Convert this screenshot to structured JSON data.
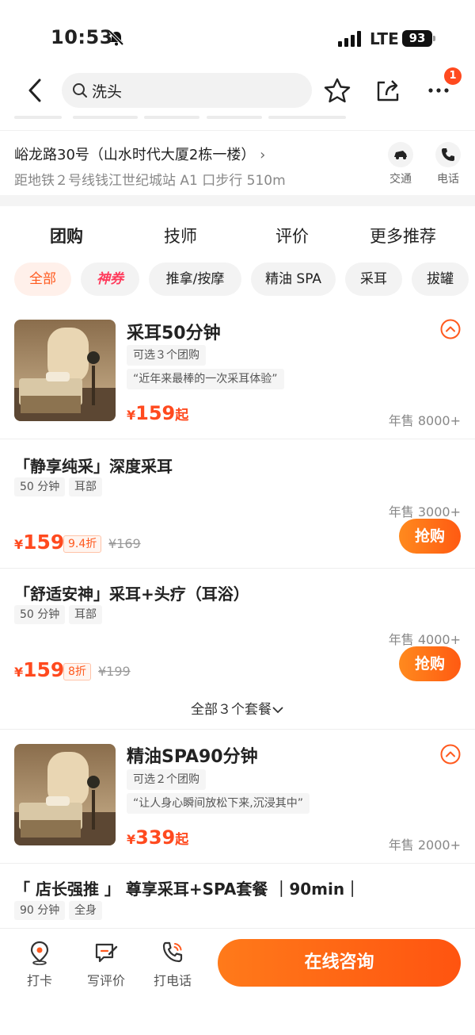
{
  "status_bar": {
    "time": "10:53",
    "network": "LTE",
    "battery": "93"
  },
  "nav": {
    "search_text": "洗头",
    "more_badge": "1"
  },
  "address": {
    "line1": "峪龙路30号（山水时代大厦2栋一楼）",
    "line2": "距地铁２号线钱江世纪城站 A1 口步行 510m",
    "traffic_label": "交通",
    "phone_label": "电话"
  },
  "tabs": [
    "团购",
    "技师",
    "评价",
    "更多推荐"
  ],
  "chips": [
    "全部",
    "神券",
    "推拿/按摩",
    "精油 SPA",
    "采耳",
    "拔罐"
  ],
  "groups": [
    {
      "title": "采耳50分钟",
      "tag1": "可选３个团购",
      "quote": "“近年来最棒的一次采耳体验”",
      "price_symbol": "¥",
      "price": "159",
      "price_suffix": "起",
      "sold": "年售 8000+"
    },
    {
      "title": "精油SPA90分钟",
      "tag1": "可选２个团购",
      "quote": "“让人身心瞬间放松下来,沉浸其中”",
      "price_symbol": "¥",
      "price": "339",
      "price_suffix": "起",
      "sold": "年售 2000+"
    }
  ],
  "items": [
    {
      "title": "「静享纯采」深度采耳",
      "tags": [
        "50 分钟",
        "耳部"
      ],
      "sold": "年售 3000+",
      "price_symbol": "¥",
      "price": "159",
      "discount": "9.4折",
      "original": "¥169",
      "buy_label": "抢购"
    },
    {
      "title": "「舒适安神」采耳+头疗（耳浴）",
      "tags": [
        "50 分钟",
        "耳部"
      ],
      "sold": "年售 4000+",
      "price_symbol": "¥",
      "price": "159",
      "discount": "8折",
      "original": "¥199",
      "buy_label": "抢购"
    },
    {
      "title": "「 店长强推 」 尊享采耳+SPA套餐 ｜90min｜",
      "tags": [
        "90 分钟",
        "全身"
      ]
    }
  ],
  "all_packages": "全部３个套餐",
  "bottom_bar": {
    "checkin": "打卡",
    "review": "写评价",
    "call": "打电话",
    "consult": "在线咨询"
  },
  "colors": {
    "accent": "#ff5a1f",
    "price": "#ff4a1f"
  }
}
